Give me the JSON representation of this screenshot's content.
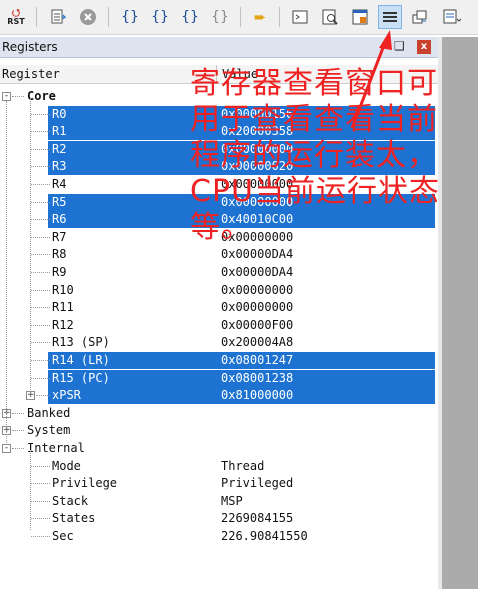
{
  "toolbar": {
    "reset_label": "RST",
    "items": [
      {
        "icon": "reset-icon"
      },
      {
        "icon": "step-over-icon"
      },
      {
        "icon": "stop-icon"
      },
      {
        "icon": "step-into-icon"
      },
      {
        "icon": "step-over-brace-icon"
      },
      {
        "icon": "step-out-icon"
      },
      {
        "icon": "run-to-cursor-icon"
      },
      {
        "icon": "show-next-statement-icon"
      },
      {
        "icon": "command-window-icon"
      },
      {
        "icon": "disassembly-window-icon"
      },
      {
        "icon": "symbols-window-icon"
      },
      {
        "icon": "registers-window-icon"
      },
      {
        "icon": "call-stack-window-icon"
      },
      {
        "icon": "watch-window-icon"
      }
    ]
  },
  "panel": {
    "title": "Registers",
    "pin_icon": "❑",
    "close_icon": "x",
    "col_register": "Register",
    "col_value": "Value"
  },
  "tree": {
    "core": "Core",
    "registers": [
      {
        "name": "R0",
        "value": "0x00000156",
        "selected": true
      },
      {
        "name": "R1",
        "value": "0x20000358",
        "selected": true
      },
      {
        "name": "R2",
        "value": "0x00000000",
        "selected": true
      },
      {
        "name": "R3",
        "value": "0x00000020",
        "selected": true
      },
      {
        "name": "R4",
        "value": "0x00000000",
        "selected": false
      },
      {
        "name": "R5",
        "value": "0x00000000",
        "selected": true
      },
      {
        "name": "R6",
        "value": "0x40010C00",
        "selected": true
      },
      {
        "name": "R7",
        "value": "0x00000000",
        "selected": false
      },
      {
        "name": "R8",
        "value": "0x00000DA4",
        "selected": false
      },
      {
        "name": "R9",
        "value": "0x00000DA4",
        "selected": false
      },
      {
        "name": "R10",
        "value": "0x00000000",
        "selected": false
      },
      {
        "name": "R11",
        "value": "0x00000000",
        "selected": false
      },
      {
        "name": "R12",
        "value": "0x00000F00",
        "selected": false
      },
      {
        "name": "R13 (SP)",
        "value": "0x200004A8",
        "selected": false
      },
      {
        "name": "R14 (LR)",
        "value": "0x08001247",
        "selected": true
      },
      {
        "name": "R15 (PC)",
        "value": "0x08001238",
        "selected": true
      },
      {
        "name": "xPSR",
        "value": "0x81000000",
        "selected": true
      }
    ],
    "banked": "Banked",
    "system": "System",
    "internal": "Internal",
    "internal_items": [
      {
        "name": "Mode",
        "value": "Thread"
      },
      {
        "name": "Privilege",
        "value": "Privileged"
      },
      {
        "name": "Stack",
        "value": "MSP"
      },
      {
        "name": "States",
        "value": "2269084155"
      },
      {
        "name": "Sec",
        "value": "226.90841550"
      }
    ]
  },
  "annotation": {
    "text": "寄存器查看窗口可用于查看查看当前程序的运行装太，CPU当前运行状态等。",
    "color": "#ee2222"
  },
  "colors": {
    "selection": "#1e73d2",
    "panel_bg": "#ffffff",
    "side_grey": "#ababab"
  }
}
